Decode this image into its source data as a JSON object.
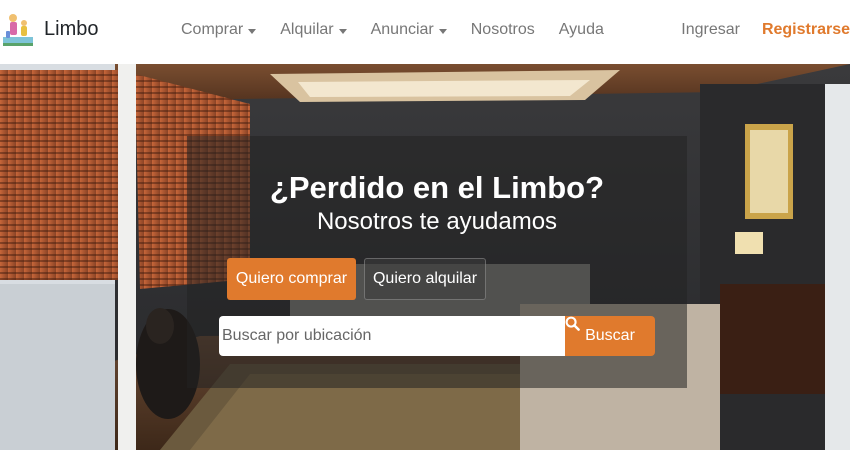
{
  "brand": {
    "name": "Limbo",
    "logo_icon": "family-logo-icon"
  },
  "nav": {
    "items": [
      {
        "label": "Comprar",
        "dropdown": true
      },
      {
        "label": "Alquilar",
        "dropdown": true
      },
      {
        "label": "Anunciar",
        "dropdown": true
      },
      {
        "label": "Nosotros",
        "dropdown": false
      },
      {
        "label": "Ayuda",
        "dropdown": false
      }
    ],
    "login": "Ingresar",
    "register": "Registrarse"
  },
  "hero": {
    "title": "¿Perdido en el Limbo?",
    "subtitle": "Nosotros te ayudamos",
    "tabs": {
      "buy": "Quiero comprar",
      "rent": "Quiero alquilar"
    },
    "search": {
      "placeholder": "Buscar por ubicación",
      "value": "",
      "button": "Buscar",
      "icon": "search-icon"
    },
    "background": "living-room-photo"
  },
  "colors": {
    "accent": "#e07a2d",
    "nav_text": "#777777",
    "brand_text": "#212529"
  }
}
